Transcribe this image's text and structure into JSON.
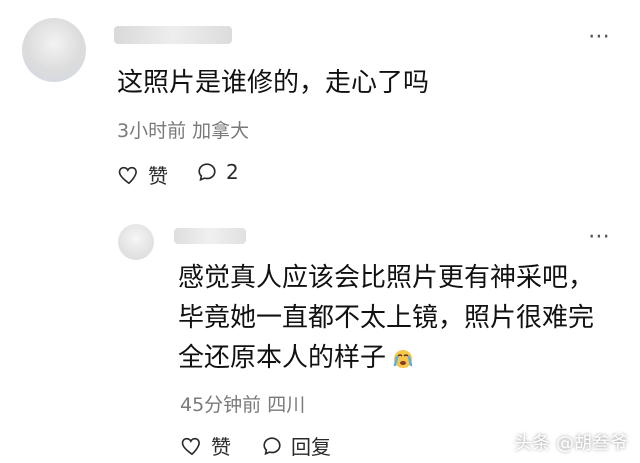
{
  "comment": {
    "text": "这照片是谁修的，走心了吗",
    "meta": "3小时前 加拿大",
    "like_label": "赞",
    "reply_count": "2",
    "more": "⋮"
  },
  "reply": {
    "text": "感觉真人应该会比照片更有神采吧，毕竟她一直都不太上镜，照片很难完全还原本人的样子",
    "meta": "45分钟前 四川",
    "like_label": "赞",
    "reply_label": "回复",
    "more": "⋮"
  },
  "watermark": "头条 @胡叁爷",
  "colors": {
    "text": "#111111",
    "meta": "#7a7a7a"
  }
}
